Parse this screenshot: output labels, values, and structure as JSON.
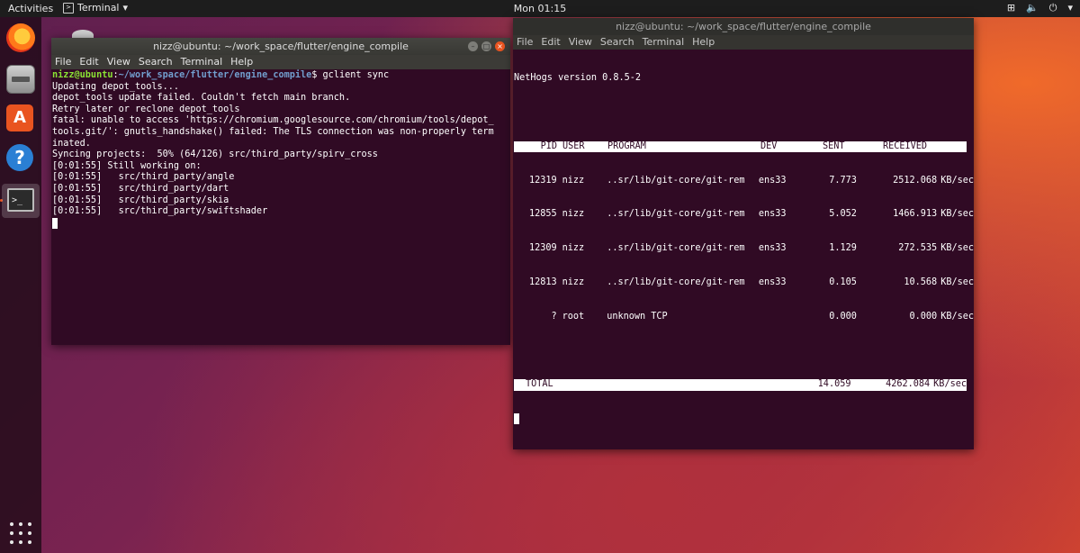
{
  "topbar": {
    "activities": "Activities",
    "app_menu": "Terminal",
    "app_menu_arrow": "▾",
    "clock": "Mon 01:15",
    "tray_network": "⊞",
    "tray_volume": "🔈",
    "tray_power": "⏻",
    "tray_arrow": "▾"
  },
  "dock": {
    "items": [
      "firefox-icon",
      "files-icon",
      "software-icon",
      "help-icon",
      "terminal-icon",
      "show-apps-icon"
    ],
    "software_glyph": "A",
    "help_glyph": "?",
    "terminal_glyph": ">_"
  },
  "window_left": {
    "title": "nizz@ubuntu: ~/work_space/flutter/engine_compile",
    "menu": [
      "File",
      "Edit",
      "View",
      "Search",
      "Terminal",
      "Help"
    ],
    "prompt_user": "nizz@ubuntu",
    "prompt_sep": ":",
    "prompt_path": "~/work_space/flutter/engine_compile",
    "prompt_cmd": "$ gclient sync",
    "output": [
      "Updating depot_tools...",
      "depot_tools update failed. Couldn't fetch main branch.",
      "Retry later or reclone depot_tools",
      "fatal: unable to access 'https://chromium.googlesource.com/chromium/tools/depot_",
      "tools.git/': gnutls_handshake() failed: The TLS connection was non-properly term",
      "inated.",
      "Syncing projects:  50% (64/126) src/third_party/spirv_cross",
      "[0:01:55] Still working on:",
      "[0:01:55]   src/third_party/angle",
      "[0:01:55]   src/third_party/dart",
      "[0:01:55]   src/third_party/skia",
      "[0:01:55]   src/third_party/swiftshader"
    ]
  },
  "window_right": {
    "title": "nizz@ubuntu: ~/work_space/flutter/engine_compile",
    "menu": [
      "File",
      "Edit",
      "View",
      "Search",
      "Terminal",
      "Help"
    ],
    "version": "NetHogs version 0.8.5-2",
    "headers": {
      "pid": "PID",
      "user": "USER",
      "program": "PROGRAM",
      "dev": "DEV",
      "sent": "SENT",
      "received": "RECEIVED"
    },
    "rows": [
      {
        "pid": "12319",
        "user": "nizz",
        "program": "..sr/lib/git-core/git-rem",
        "dev": "ens33",
        "sent": "7.773",
        "received": "2512.068",
        "unit": "KB/sec"
      },
      {
        "pid": "12855",
        "user": "nizz",
        "program": "..sr/lib/git-core/git-rem",
        "dev": "ens33",
        "sent": "5.052",
        "received": "1466.913",
        "unit": "KB/sec"
      },
      {
        "pid": "12309",
        "user": "nizz",
        "program": "..sr/lib/git-core/git-rem",
        "dev": "ens33",
        "sent": "1.129",
        "received": "272.535",
        "unit": "KB/sec"
      },
      {
        "pid": "12813",
        "user": "nizz",
        "program": "..sr/lib/git-core/git-rem",
        "dev": "ens33",
        "sent": "0.105",
        "received": "10.568",
        "unit": "KB/sec"
      },
      {
        "pid": "?",
        "user": "root",
        "program": "unknown TCP",
        "dev": "",
        "sent": "0.000",
        "received": "0.000",
        "unit": "KB/sec"
      }
    ],
    "total": {
      "label": "TOTAL",
      "sent": "14.059",
      "received": "4262.084",
      "unit": "KB/sec"
    }
  },
  "colors": {
    "terminal_bg": "#300a24",
    "accent": "#e95420",
    "prompt_user": "#8ae234",
    "prompt_path": "#729fcf"
  }
}
